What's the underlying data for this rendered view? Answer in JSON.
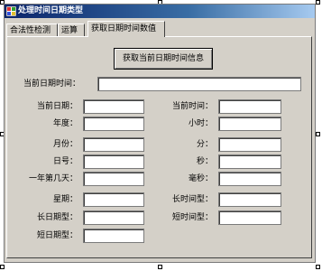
{
  "window": {
    "title": "处理时间日期类型"
  },
  "tabs": [
    {
      "label": "合法性检测"
    },
    {
      "label": "运算"
    },
    {
      "label": "获取日期时间数值"
    }
  ],
  "panel": {
    "get_button_label": "获取当前日期时间信息",
    "current_datetime_label": "当前日期时间：",
    "current_datetime_value": "",
    "left_fields": [
      {
        "label": "当前日期：",
        "value": ""
      },
      {
        "label": "年度：",
        "value": ""
      },
      {
        "label": "月份：",
        "value": ""
      },
      {
        "label": "日号：",
        "value": ""
      },
      {
        "label": "一年第几天：",
        "value": ""
      },
      {
        "label": "星期：",
        "value": ""
      },
      {
        "label": "长日期型：",
        "value": ""
      },
      {
        "label": "短日期型：",
        "value": ""
      }
    ],
    "right_fields": [
      {
        "label": "当前时间：",
        "value": ""
      },
      {
        "label": "小时：",
        "value": ""
      },
      {
        "label": "分：",
        "value": ""
      },
      {
        "label": "秒：",
        "value": ""
      },
      {
        "label": "毫秒：",
        "value": ""
      },
      {
        "label": "长时间型：",
        "value": ""
      },
      {
        "label": "短时间型：",
        "value": ""
      }
    ]
  }
}
